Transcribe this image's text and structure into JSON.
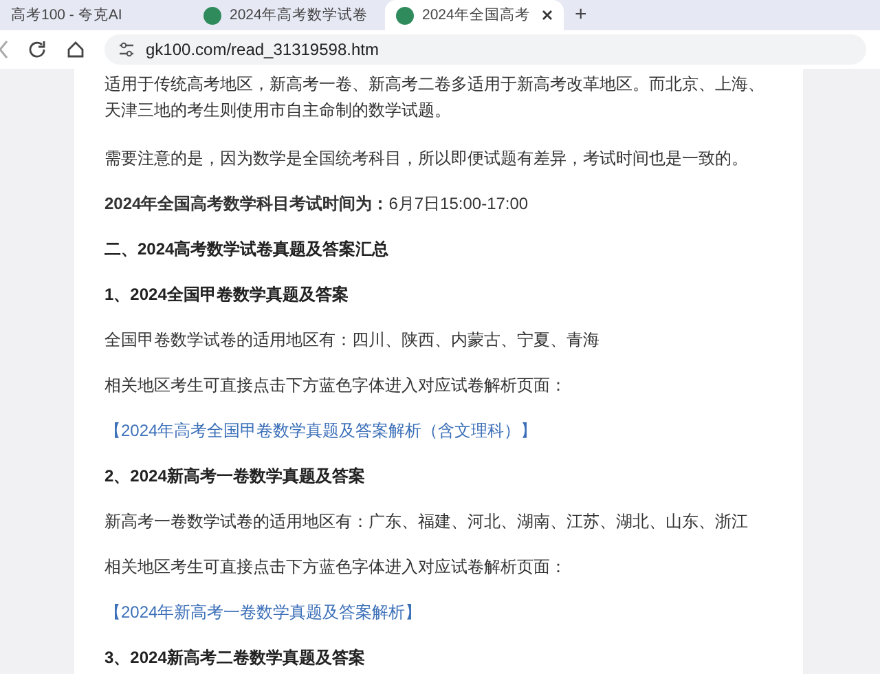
{
  "tabs": [
    {
      "title": "高考100 - 夸克AI",
      "selected": false,
      "has_icon": false
    },
    {
      "title": "2024年高考数学试卷",
      "selected": false,
      "has_icon": true
    },
    {
      "title": "2024年全国高考",
      "selected": true,
      "has_icon": true
    }
  ],
  "new_tab": "+",
  "address_bar": {
    "url": "gk100.com/read_31319598.htm"
  },
  "article": [
    {
      "kind": "paragraph",
      "text": "适用于传统高考地区，新高考一卷、新高考二卷多适用于新高考改革地区。而北京、上海、天津三地的考生则使用市自主命制的数学试题。"
    },
    {
      "kind": "paragraph",
      "text": "需要注意的是，因为数学是全国统考科目，所以即便试题有差异，考试时间也是一致的。"
    },
    {
      "kind": "paragraph",
      "text": "**2024年全国高考数学科目考试时间为：**6月7日15:00-17:00"
    },
    {
      "kind": "heading",
      "text": "二、2024高考数学试卷真题及答案汇总"
    },
    {
      "kind": "heading",
      "text": "1、2024全国甲卷数学真题及答案"
    },
    {
      "kind": "paragraph",
      "text": "全国甲卷数学试卷的适用地区有：四川、陕西、内蒙古、宁夏、青海"
    },
    {
      "kind": "paragraph",
      "text": "相关地区考生可直接点击下方蓝色字体进入对应试卷解析页面："
    },
    {
      "kind": "link",
      "text": "【2024年高考全国甲卷数学真题及答案解析（含文理科）】"
    },
    {
      "kind": "heading",
      "text": "2、2024新高考一卷数学真题及答案"
    },
    {
      "kind": "paragraph",
      "text": "新高考一卷数学试卷的适用地区有：广东、福建、河北、湖南、江苏、湖北、山东、浙江"
    },
    {
      "kind": "paragraph",
      "text": "相关地区考生可直接点击下方蓝色字体进入对应试卷解析页面："
    },
    {
      "kind": "link",
      "text": "【2024年新高考一卷数学真题及答案解析】"
    },
    {
      "kind": "heading",
      "text": "3、2024新高考二卷数学真题及答案"
    }
  ]
}
